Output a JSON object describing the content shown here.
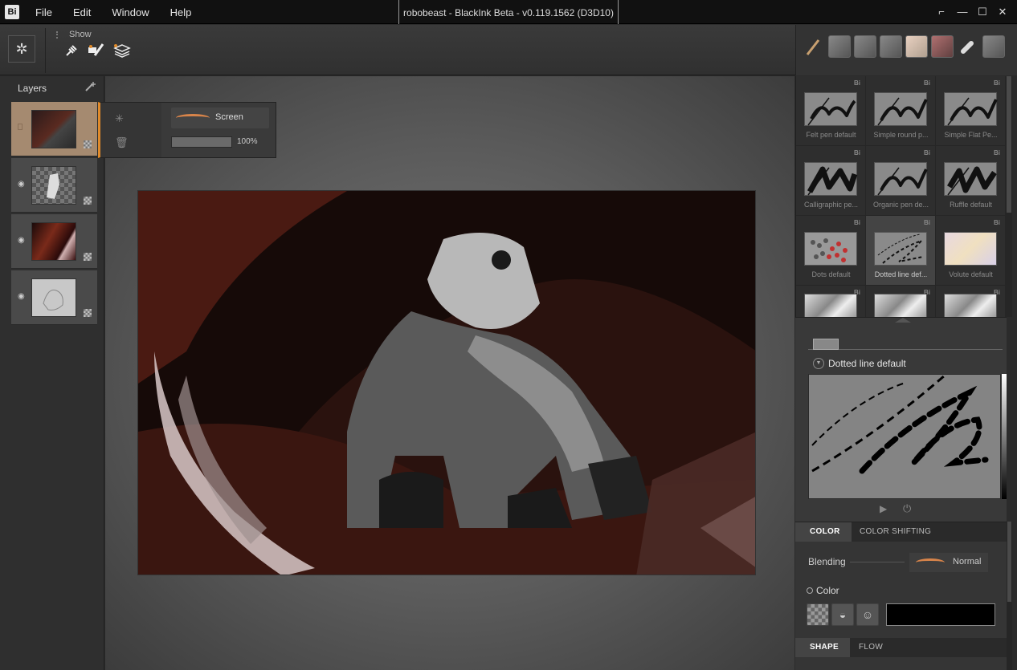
{
  "app": {
    "logo": "Bi",
    "title": "robobeast - BlackInk Beta - v0.119.1562 (D3D10)"
  },
  "menu": [
    "File",
    "Edit",
    "Window",
    "Help"
  ],
  "window_controls": [
    "restore-down",
    "minimize",
    "maximize",
    "close"
  ],
  "toolbar": {
    "show_label": "Show",
    "icons": [
      "settings-icon",
      "plug-icon",
      "brush-eraser-icon",
      "layers-icon"
    ]
  },
  "layers": {
    "title": "Layers",
    "items": [
      {
        "name": "layer-1",
        "visible": false,
        "active": true
      },
      {
        "name": "layer-2",
        "visible": true,
        "active": false
      },
      {
        "name": "layer-3",
        "visible": true,
        "active": false
      },
      {
        "name": "layer-4",
        "visible": true,
        "active": false
      }
    ]
  },
  "layer_popup": {
    "blend_mode": "Screen",
    "opacity": "100%",
    "opacity_fraction": 1.0
  },
  "brushes": [
    {
      "name": "Felt pen default",
      "tag": "Bi"
    },
    {
      "name": "Simple round p...",
      "tag": "Bi"
    },
    {
      "name": "Simple Flat Pe...",
      "tag": "Bi"
    },
    {
      "name": "Calligraphic pe...",
      "tag": "Bi"
    },
    {
      "name": "Organic pen de...",
      "tag": "Bi"
    },
    {
      "name": "Ruffle default",
      "tag": "Bi"
    },
    {
      "name": "Dots default",
      "tag": "Bi"
    },
    {
      "name": "Dotted line def...",
      "tag": "Bi",
      "selected": true
    },
    {
      "name": "Volute default",
      "tag": "Bi"
    },
    {
      "name": "",
      "tag": "Bi"
    },
    {
      "name": "",
      "tag": "Bi"
    },
    {
      "name": "",
      "tag": "Bi"
    }
  ],
  "preview": {
    "brush_name": "Dotted line default"
  },
  "color_panel": {
    "tabs": [
      "COLOR",
      "COLOR SHIFTING"
    ],
    "blending_label": "Blending",
    "blending_value": "Normal",
    "color_label": "Color",
    "current_color": "#000000",
    "bottom_tabs": [
      "SHAPE",
      "FLOW"
    ]
  },
  "colors": {
    "accent": "#e08a2a",
    "active_layer": "#a58a70"
  }
}
